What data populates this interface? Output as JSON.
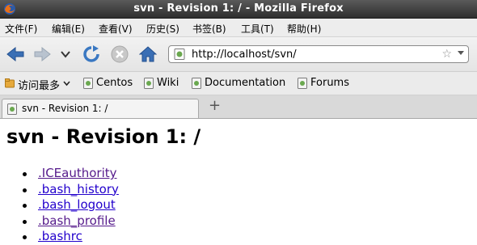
{
  "window": {
    "title": "svn - Revision 1: / - Mozilla Firefox"
  },
  "menubar": {
    "items": [
      {
        "label": "文件(F)"
      },
      {
        "label": "编辑(E)"
      },
      {
        "label": "查看(V)"
      },
      {
        "label": "历史(S)"
      },
      {
        "label": "书签(B)"
      },
      {
        "label": "工具(T)"
      },
      {
        "label": "帮助(H)"
      }
    ]
  },
  "navbar": {
    "url": "http://localhost/svn/",
    "icons": [
      "back-arrow-icon",
      "forward-arrow-icon",
      "history-dropdown-icon",
      "reload-icon",
      "stop-icon",
      "home-icon",
      "bookmark-star-icon"
    ]
  },
  "bookmarks": {
    "items": [
      {
        "label": "访问最多",
        "icon": "smart-folder-icon"
      },
      {
        "label": "Centos",
        "icon": "page-icon"
      },
      {
        "label": "Wiki",
        "icon": "page-icon"
      },
      {
        "label": "Documentation",
        "icon": "page-icon"
      },
      {
        "label": "Forums",
        "icon": "page-icon"
      }
    ]
  },
  "tabs": [
    {
      "label": "svn - Revision 1: /",
      "active": true
    }
  ],
  "page": {
    "heading": "svn - Revision 1: /",
    "files": [
      {
        "name": ".ICEauthority",
        "visited": true
      },
      {
        "name": ".bash_history",
        "visited": false
      },
      {
        "name": ".bash_logout",
        "visited": false
      },
      {
        "name": ".bash_profile",
        "visited": true
      },
      {
        "name": ".bashrc",
        "visited": false
      }
    ]
  },
  "colors": {
    "link": "#2200cc",
    "visited_link": "#551a8b",
    "titlebar": "#3c3c3c",
    "nav_arrow": "#3a6fb5"
  }
}
